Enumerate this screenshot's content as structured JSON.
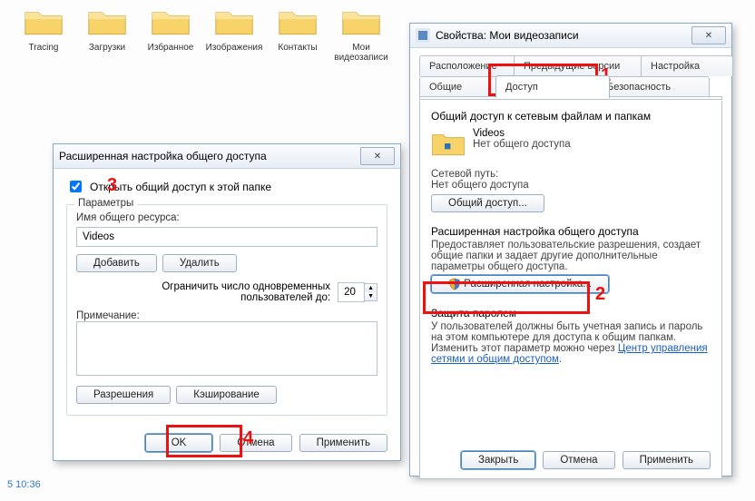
{
  "desktop_folders": [
    "Tracing",
    "Загрузки",
    "Избранное",
    "Изображения",
    "Контакты",
    "Мои видеозаписи"
  ],
  "status_time": "5 10:36",
  "properties": {
    "title": "Свойства: Мои видеозаписи",
    "tabs_row1": [
      "Расположение",
      "Предыдущие версии",
      "Настройка"
    ],
    "tabs_row2": [
      "Общие",
      "Доступ",
      "Безопасность"
    ],
    "active_tab": "Доступ",
    "share_header": "Общий доступ к сетевым файлам и папкам",
    "share_name": "Videos",
    "share_status": "Нет общего доступа",
    "net_path_label": "Сетевой путь:",
    "net_path_value": "Нет общего доступа",
    "share_button": "Общий доступ...",
    "adv_header": "Расширенная настройка общего доступа",
    "adv_desc": "Предоставляет пользовательские разрешения, создает общие папки и задает другие дополнительные параметры общего доступа.",
    "adv_button": "Расширенная настройка...",
    "pw_header": "Защита паролем",
    "pw_desc": "У пользователей должны быть учетная запись и пароль на этом компьютере для доступа к общим папкам. Изменить этот параметр можно через ",
    "pw_link": "Центр управления сетями и общим доступом",
    "btn_close": "Закрыть",
    "btn_cancel": "Отмена",
    "btn_apply": "Применить"
  },
  "adv": {
    "title": "Расширенная настройка общего доступа",
    "chk_label": "Открыть общий доступ к этой папке",
    "chk_checked": true,
    "grp_label": "Параметры",
    "share_name_label": "Имя общего ресурса:",
    "share_name_value": "Videos",
    "btn_add": "Добавить",
    "btn_remove": "Удалить",
    "limit_label1": "Ограничить число одновременных",
    "limit_label2": "пользователей до:",
    "limit_value": "20",
    "note_label": "Примечание:",
    "btn_perm": "Разрешения",
    "btn_cache": "Кэширование",
    "btn_ok": "OK",
    "btn_cancel": "Отмена",
    "btn_apply": "Применить"
  },
  "annotations": {
    "n1": "1",
    "n2": "2",
    "n3": "3",
    "n4": "4"
  }
}
